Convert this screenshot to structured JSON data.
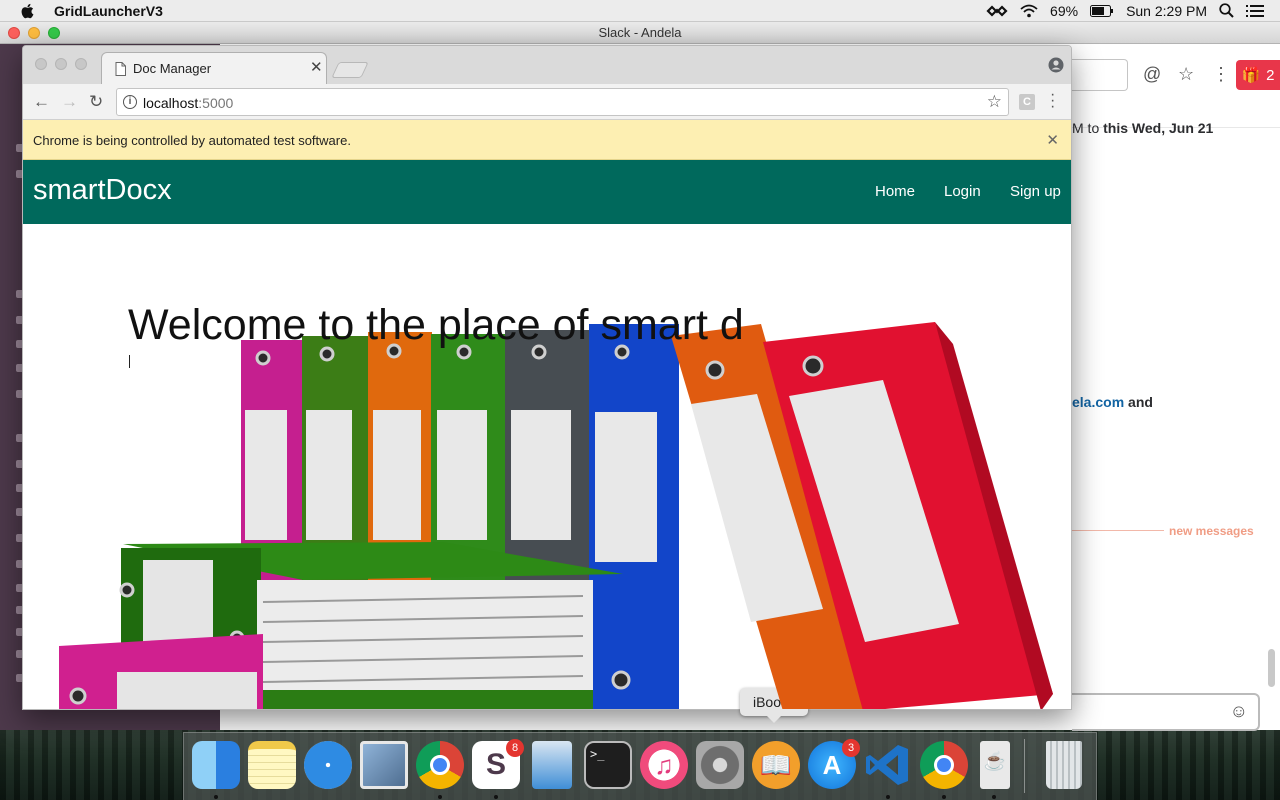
{
  "menubar": {
    "app_name": "GridLauncherV3",
    "battery": "69%",
    "clock": "Sun 2:29 PM"
  },
  "slack": {
    "window_title": "Slack - Andela",
    "gift_count": "2",
    "text_date_prefix": "M to",
    "text_date": "this Wed, Jun 21",
    "link_fragment": "ela.com",
    "link_suffix": "and",
    "new_messages": "new messages"
  },
  "browser": {
    "tab_title": "Doc Manager",
    "url_host": "localhost",
    "url_port": ":5000",
    "ext_label": "C",
    "infobar_message": "Chrome is being controlled by automated test software."
  },
  "app": {
    "brand": "smartDocx",
    "nav": [
      {
        "label": "Home"
      },
      {
        "label": "Login"
      },
      {
        "label": "Sign up"
      }
    ],
    "headline": "Welcome to the place of smart d"
  },
  "dock": {
    "tooltip": "iBooks",
    "items": [
      {
        "name": "Finder",
        "color": "#3d8fe8"
      },
      {
        "name": "Notes",
        "color": "#f8e27a"
      },
      {
        "name": "Safari",
        "color": "#2e8be3"
      },
      {
        "name": "Preview",
        "color": "#6e8fb5"
      },
      {
        "name": "Chrome",
        "color": "#dd4b3e"
      },
      {
        "name": "Slack",
        "color": "#ffffff",
        "badge": "8"
      },
      {
        "name": "Keynote",
        "color": "#3f8ed6"
      },
      {
        "name": "Terminal",
        "color": "#1e1e1e"
      },
      {
        "name": "iTunes",
        "color": "#f04b7c"
      },
      {
        "name": "System Preferences",
        "color": "#8c8c8c"
      },
      {
        "name": "iBooks",
        "color": "#f29f2b"
      },
      {
        "name": "App Store",
        "color": "#1d9bf0",
        "badge": "3"
      },
      {
        "name": "Visual Studio Code",
        "color": "#1e73c8"
      },
      {
        "name": "Chrome",
        "color": "#dd4b3e"
      },
      {
        "name": "Java",
        "color": "#e9e9e9"
      },
      {
        "name": "Trash",
        "color": "#d0d4d6"
      }
    ]
  }
}
